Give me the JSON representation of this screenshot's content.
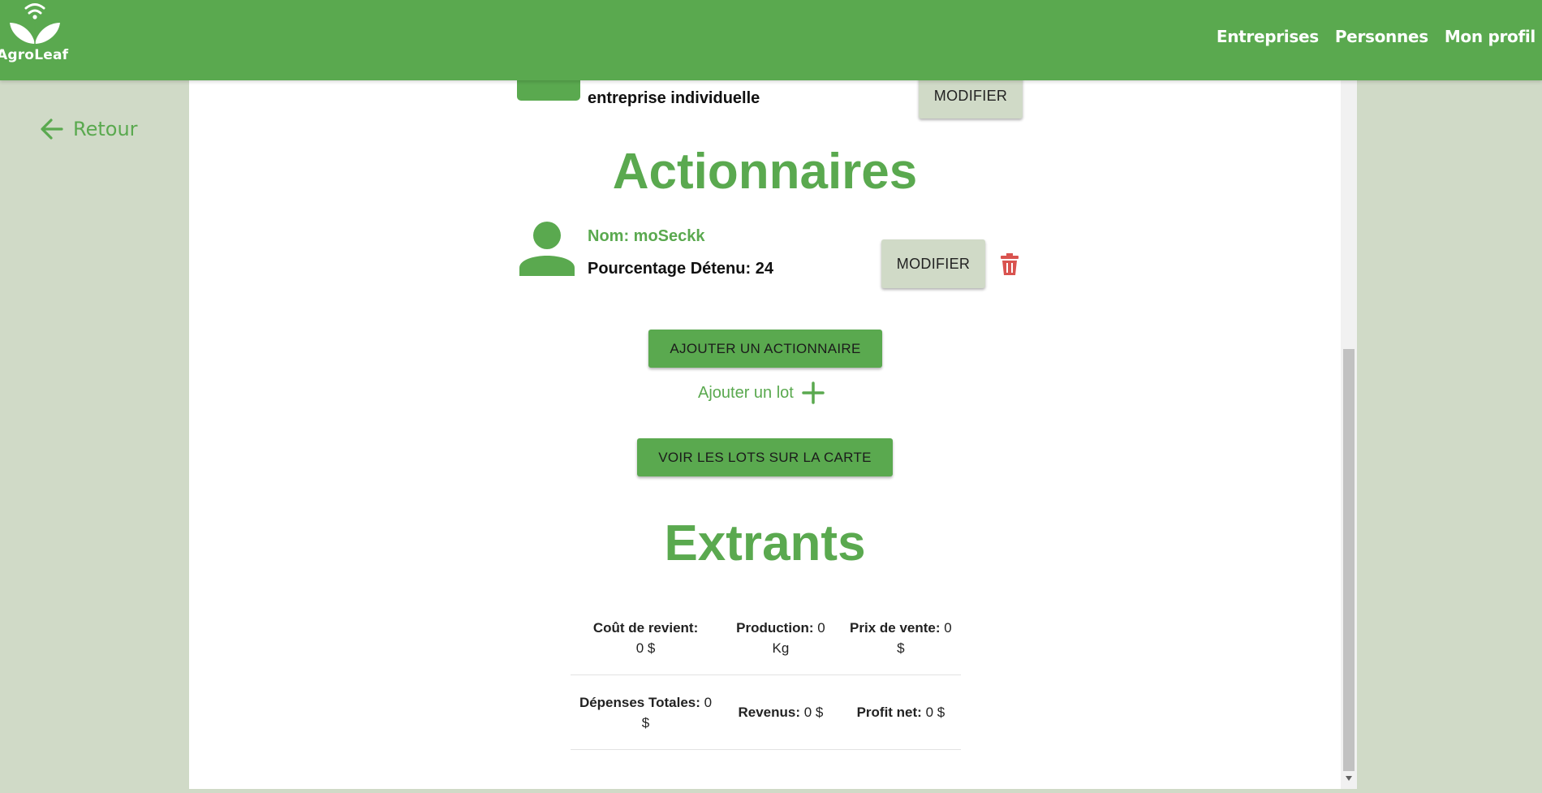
{
  "app": {
    "name": "AgroLeaf"
  },
  "nav": {
    "items": [
      "Entreprises",
      "Personnes",
      "Mon profil"
    ]
  },
  "back": {
    "label": "Retour"
  },
  "company": {
    "type_text": "entreprise individuelle",
    "modify_label": "MODIFIER"
  },
  "shareholders": {
    "title": "Actionnaires",
    "items": [
      {
        "name_text": "Nom: moSeckk",
        "percent_text": "Pourcentage Détenu: 24",
        "modify_label": "MODIFIER"
      }
    ],
    "add_label": "AJOUTER UN ACTIONNAIRE"
  },
  "lots": {
    "add_label": "Ajouter un lot",
    "map_label": "VOIR LES LOTS SUR LA CARTE"
  },
  "extrants": {
    "title": "Extrants",
    "rows": [
      [
        {
          "label": "Coût de revient:",
          "value": "0 $"
        },
        {
          "label": "Production:",
          "value": "0 Kg"
        },
        {
          "label": "Prix de vente:",
          "value": "0 $"
        }
      ],
      [
        {
          "label": "Dépenses Totales:",
          "value": "0 $"
        },
        {
          "label": "Revenus:",
          "value": "0 $"
        },
        {
          "label": "Profit net:",
          "value": "0 $"
        }
      ]
    ]
  },
  "colors": {
    "brand": "#5aa94f",
    "background": "#d0dac7",
    "danger": "#d9534f"
  }
}
